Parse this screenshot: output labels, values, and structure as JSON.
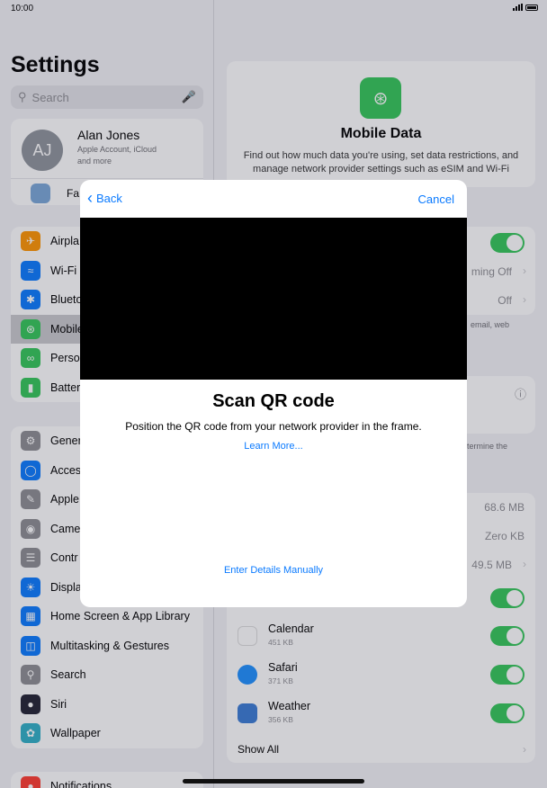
{
  "status": {
    "time": "10:00"
  },
  "sidebar": {
    "title": "Settings",
    "search_placeholder": "Search",
    "profile": {
      "initials": "AJ",
      "name": "Alan Jones",
      "subtitle_line1": "Apple Account, iCloud",
      "subtitle_line2": "and more",
      "family_label": "Fa"
    },
    "group_connectivity": [
      {
        "label": "Airpla",
        "icon": "airplane-icon",
        "color": "#ff9500"
      },
      {
        "label": "Wi-Fi",
        "icon": "wifi-icon",
        "color": "#0a7aff"
      },
      {
        "label": "Blueto",
        "icon": "bluetooth-icon",
        "color": "#0a7aff"
      },
      {
        "label": "Mobile",
        "icon": "antenna-icon",
        "color": "#34c759",
        "selected": true
      },
      {
        "label": "Perso",
        "icon": "hotspot-icon",
        "color": "#34c759"
      },
      {
        "label": "Batter",
        "icon": "battery-icon",
        "color": "#34c759"
      }
    ],
    "group_general": [
      {
        "label": "Gener",
        "icon": "gear-icon",
        "color": "#8e8e93"
      },
      {
        "label": "Access",
        "icon": "accessibility-icon",
        "color": "#0a7aff"
      },
      {
        "label": "Apple",
        "icon": "pencil-icon",
        "color": "#8e8e93"
      },
      {
        "label": "Came",
        "icon": "camera-icon",
        "color": "#8e8e93"
      },
      {
        "label": "Contr",
        "icon": "control-centre-icon",
        "color": "#8e8e93"
      },
      {
        "label": "Displa",
        "icon": "brightness-icon",
        "color": "#0a7aff"
      },
      {
        "label": "Home Screen & App Library",
        "icon": "home-screen-icon",
        "color": "#0a7aff"
      },
      {
        "label": "Multitasking & Gestures",
        "icon": "multitasking-icon",
        "color": "#0a7aff"
      },
      {
        "label": "Search",
        "icon": "search-icon",
        "color": "#8e8e93"
      },
      {
        "label": "Siri",
        "icon": "siri-icon",
        "color": "#222233"
      },
      {
        "label": "Wallpaper",
        "icon": "wallpaper-icon",
        "color": "#30b0c7"
      }
    ],
    "notifications_label": "Notifications"
  },
  "detail": {
    "hero_title": "Mobile Data",
    "hero_desc": "Find out how much data you're using, set data restrictions, and manage network provider settings such as eSIM and Wi-Fi",
    "roaming_value": "ming Off",
    "off_value": "Off",
    "note1": "email, web",
    "note2": "etermine the",
    "usage": [
      "68.6 MB",
      "Zero KB",
      "49.5 MB"
    ],
    "apps": [
      {
        "name": "Calendar",
        "size": "451 KB",
        "icon": "calendar-icon",
        "color": "#ffffff"
      },
      {
        "name": "Safari",
        "size": "371 KB",
        "icon": "safari-icon",
        "color": "#1e90ff"
      },
      {
        "name": "Weather",
        "size": "356 KB",
        "icon": "weather-icon",
        "color": "#3a7bd5"
      }
    ],
    "show_all": "Show All"
  },
  "modal": {
    "back_label": "Back",
    "cancel_label": "Cancel",
    "title": "Scan QR code",
    "description": "Position the QR code from your network provider in the frame.",
    "learn_more": "Learn More...",
    "manual_link": "Enter Details Manually"
  }
}
